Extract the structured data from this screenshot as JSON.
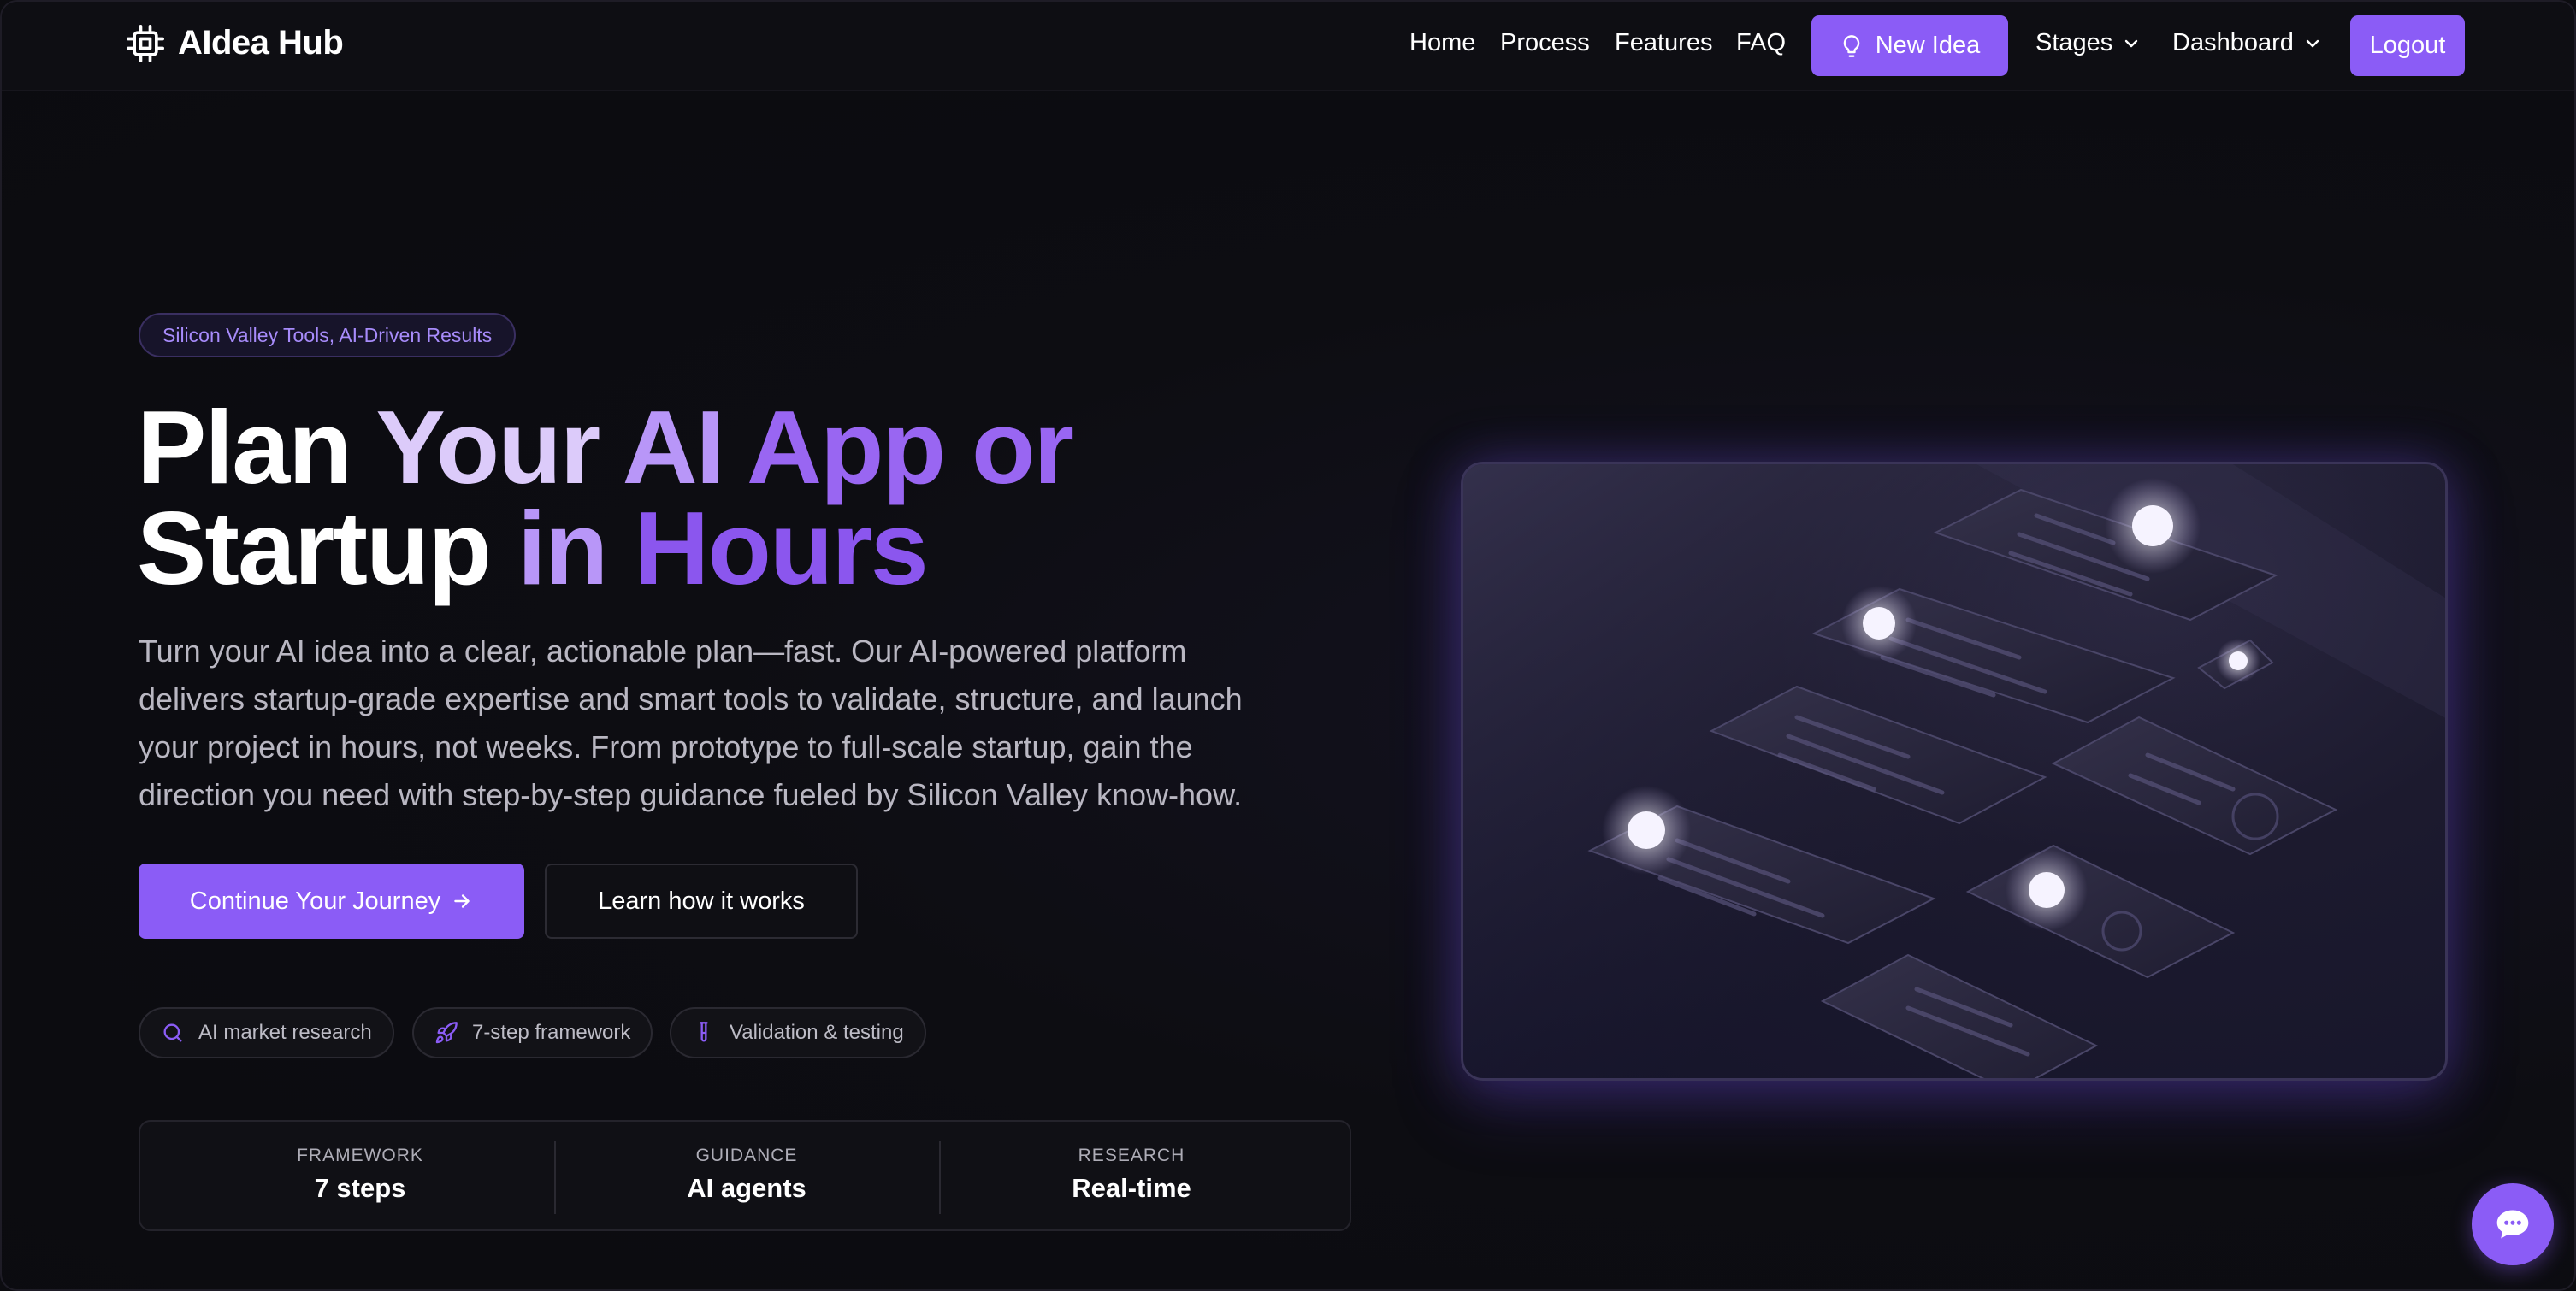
{
  "brand": {
    "name": "AIdea Hub",
    "icon": "chip-icon",
    "accent": "#8b5cf6"
  },
  "nav": {
    "links": [
      "Home",
      "Process",
      "Features",
      "FAQ"
    ],
    "new_idea": {
      "label": "New Idea",
      "icon": "lightbulb-icon"
    },
    "dropdowns": [
      "Stages",
      "Dashboard"
    ],
    "logout": "Logout"
  },
  "hero": {
    "badge": "Silicon Valley Tools, AI-Driven Results",
    "headline": {
      "w1": "Plan",
      "w2": "Your",
      "w3": "AI",
      "w4": "App or",
      "w5": "Startup",
      "w6": "in",
      "w7": "Hours"
    },
    "description": "Turn your AI idea into a clear, actionable plan—fast. Our AI-powered platform delivers startup-grade expertise and smart tools to validate, structure, and launch your project in hours, not weeks. From prototype to full-scale startup, gain the direction you need with step-by-step guidance fueled by Silicon Valley know-how.",
    "primary_button": "Continue Your Journey",
    "secondary_button": "Learn how it works",
    "chips": [
      {
        "label": "AI market research",
        "icon": "search-icon"
      },
      {
        "label": "7-step framework",
        "icon": "rocket-icon"
      },
      {
        "label": "Validation & testing",
        "icon": "test-tube-icon"
      }
    ],
    "stats": [
      {
        "label": "FRAMEWORK",
        "value": "7 steps"
      },
      {
        "label": "GUIDANCE",
        "value": "AI agents"
      },
      {
        "label": "RESEARCH",
        "value": "Real-time"
      }
    ]
  },
  "chat": {
    "icon": "chat-bubble-icon"
  }
}
